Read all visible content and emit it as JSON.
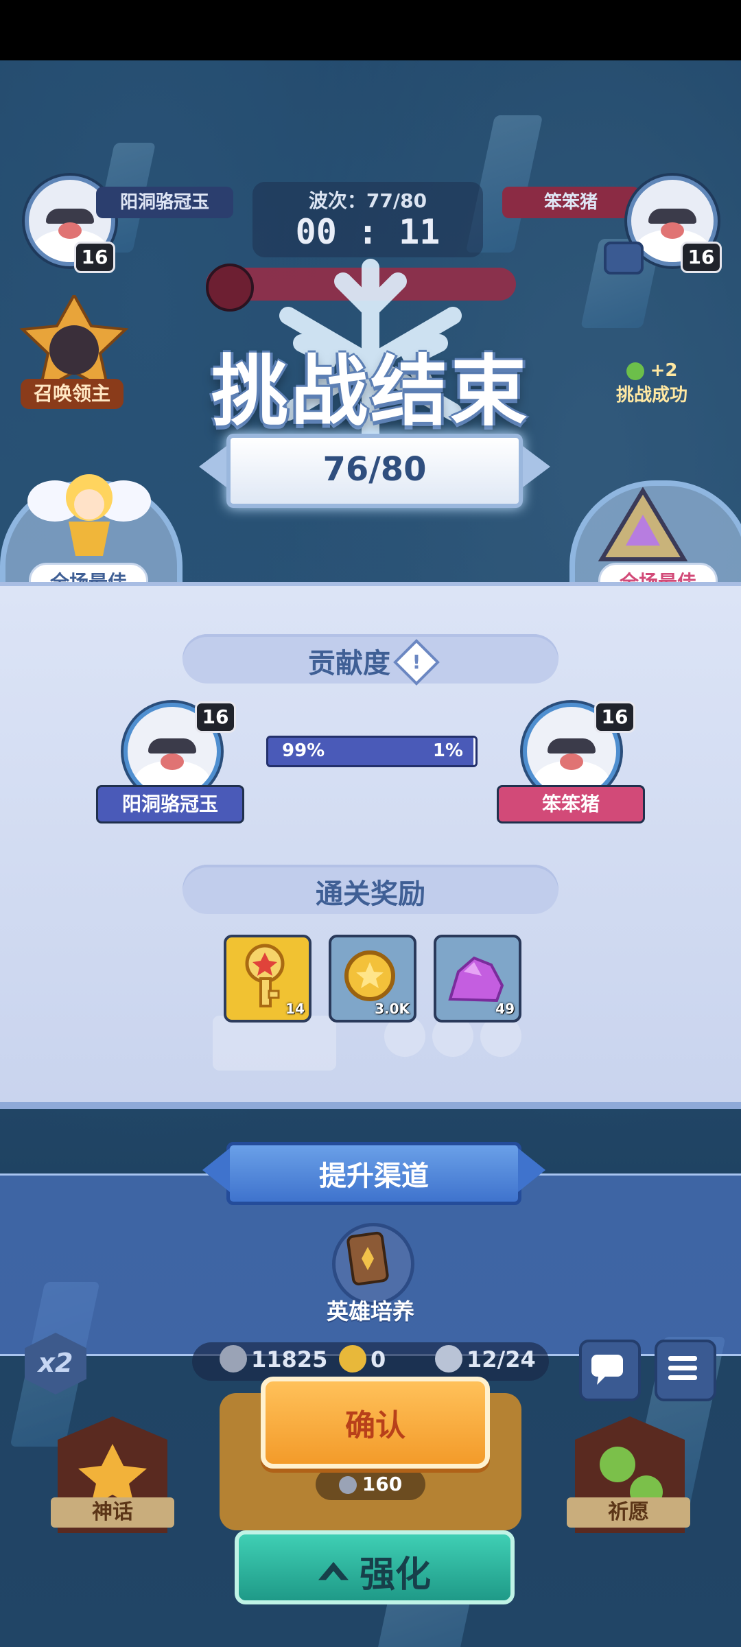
{
  "hud": {
    "left_player": {
      "name": "阳洞骆冠玉",
      "level": "16"
    },
    "right_player": {
      "name": "笨笨猪",
      "level": "16"
    },
    "wave_label": "波次：77/80",
    "timer": "00 : 11",
    "summon_label": "召唤领主",
    "reward_bonus": "+2",
    "challenge_status": "挑战成功"
  },
  "result": {
    "title": "挑战结束",
    "score": "76/80",
    "mvp_left": "全场最佳",
    "mvp_right": "全场最佳"
  },
  "contribution": {
    "title": "贡献度",
    "info_glyph": "!",
    "left": {
      "name": "阳洞骆冠玉",
      "level": "16",
      "percent": 99,
      "label": "99%"
    },
    "right": {
      "name": "笨笨猪",
      "level": "16",
      "percent": 1,
      "label": "1%"
    }
  },
  "rewards": {
    "title": "通关奖励",
    "items": [
      {
        "icon": "key-icon",
        "count": "14",
        "color": "#f1c232"
      },
      {
        "icon": "coin-icon",
        "count": "3.0K",
        "color": "#7fa6c9"
      },
      {
        "icon": "crystal-icon",
        "count": "49",
        "color": "#7fa6c9"
      }
    ]
  },
  "channel": {
    "title": "提升渠道",
    "item_label": "英雄培养"
  },
  "bottom_hud": {
    "multiplier": "x2",
    "silver": "11825",
    "clover": "0",
    "units": "12/24",
    "confirm": "确认",
    "summon_cost": "160",
    "left_card": "神话",
    "right_card": "祈愿",
    "enhance": "强化"
  },
  "colors": {
    "accent_blue": "#4a5ab8",
    "accent_pink": "#d24a78",
    "confirm_orange": "#f39b2a",
    "enhance_teal": "#1f9a88"
  }
}
